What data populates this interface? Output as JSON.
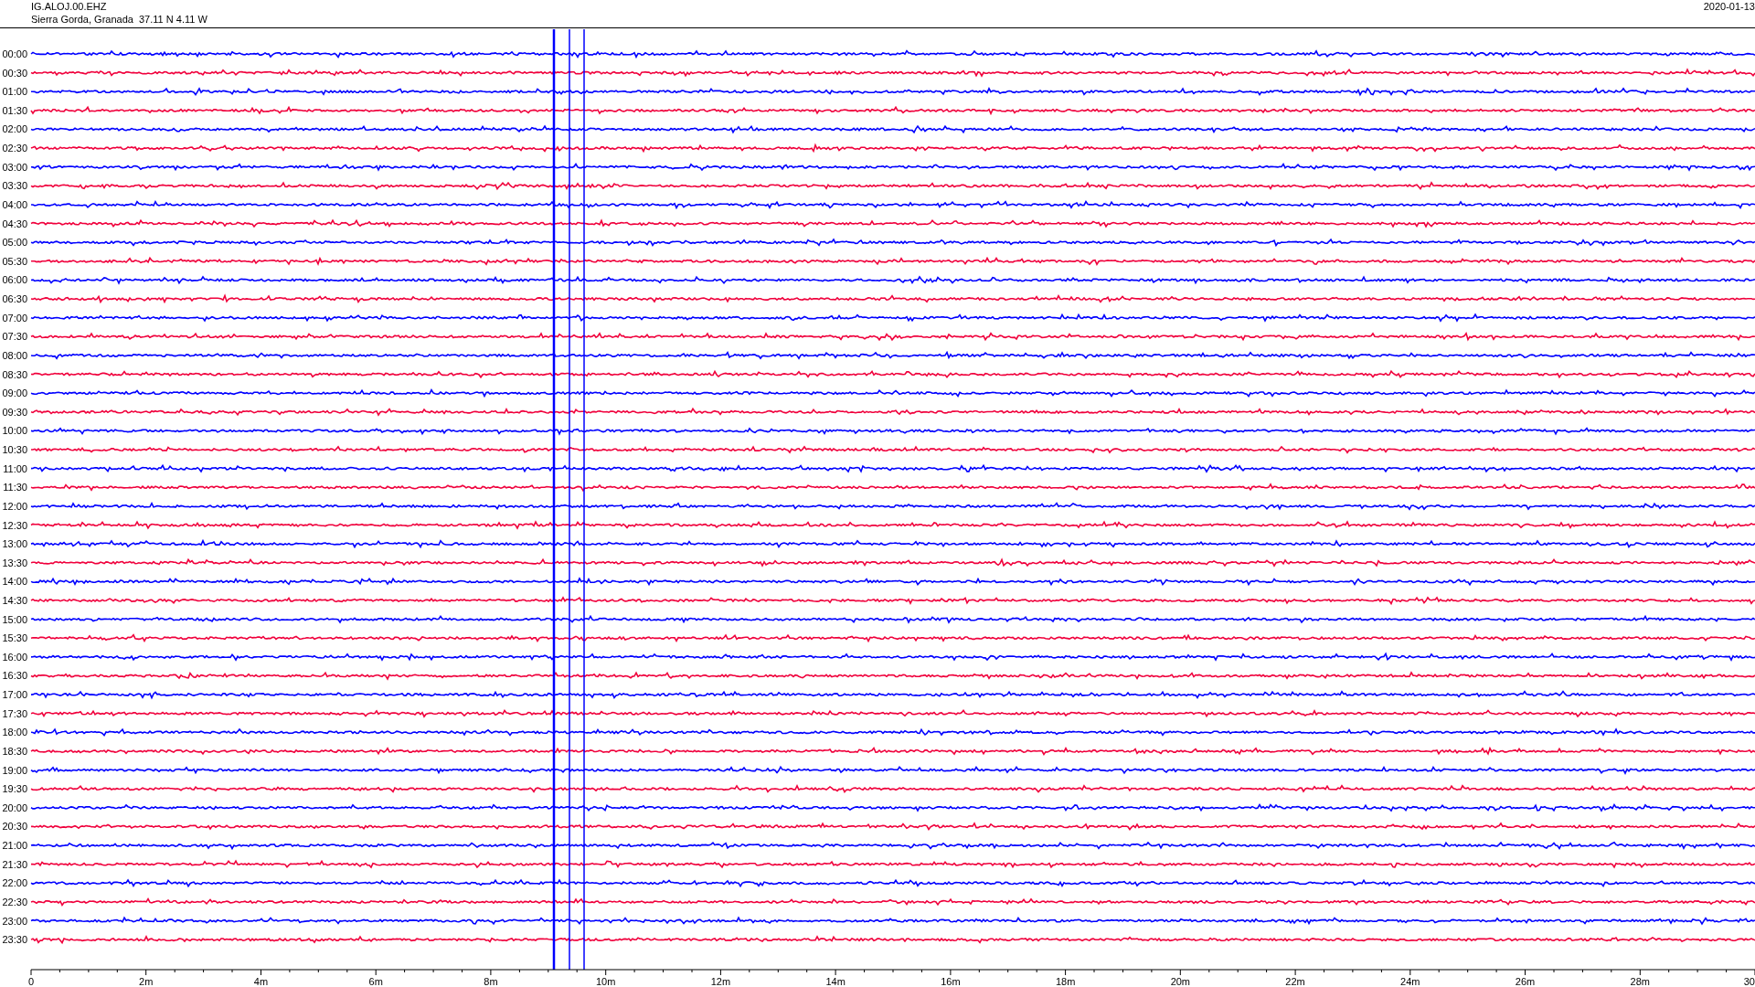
{
  "header": {
    "station": "IG.ALOJ.00.EHZ",
    "location": "Sierra Gorda, Granada  37.11 N 4.11 W",
    "date": "2020-01-13"
  },
  "traces": [
    {
      "label": "00:00",
      "color": "#0000ff"
    },
    {
      "label": "00:30",
      "color": "#f0003c"
    },
    {
      "label": "01:00",
      "color": "#0000ff"
    },
    {
      "label": "01:30",
      "color": "#f0003c"
    },
    {
      "label": "02:00",
      "color": "#0000ff"
    },
    {
      "label": "02:30",
      "color": "#f0003c"
    },
    {
      "label": "03:00",
      "color": "#0000ff"
    },
    {
      "label": "03:30",
      "color": "#f0003c"
    },
    {
      "label": "04:00",
      "color": "#0000ff"
    },
    {
      "label": "04:30",
      "color": "#f0003c"
    },
    {
      "label": "05:00",
      "color": "#0000ff"
    },
    {
      "label": "05:30",
      "color": "#f0003c"
    },
    {
      "label": "06:00",
      "color": "#0000ff"
    },
    {
      "label": "06:30",
      "color": "#f0003c"
    },
    {
      "label": "07:00",
      "color": "#0000ff"
    },
    {
      "label": "07:30",
      "color": "#f0003c"
    },
    {
      "label": "08:00",
      "color": "#0000ff"
    },
    {
      "label": "08:30",
      "color": "#f0003c"
    },
    {
      "label": "09:00",
      "color": "#0000ff"
    },
    {
      "label": "09:30",
      "color": "#f0003c"
    },
    {
      "label": "10:00",
      "color": "#0000ff"
    },
    {
      "label": "10:30",
      "color": "#f0003c"
    },
    {
      "label": "11:00",
      "color": "#0000ff"
    },
    {
      "label": "11:30",
      "color": "#f0003c"
    },
    {
      "label": "12:00",
      "color": "#0000ff"
    },
    {
      "label": "12:30",
      "color": "#f0003c"
    },
    {
      "label": "13:00",
      "color": "#0000ff"
    },
    {
      "label": "13:30",
      "color": "#f0003c"
    },
    {
      "label": "14:00",
      "color": "#0000ff"
    },
    {
      "label": "14:30",
      "color": "#f0003c"
    },
    {
      "label": "15:00",
      "color": "#0000ff"
    },
    {
      "label": "15:30",
      "color": "#f0003c"
    },
    {
      "label": "16:00",
      "color": "#0000ff"
    },
    {
      "label": "16:30",
      "color": "#f0003c"
    },
    {
      "label": "17:00",
      "color": "#0000ff"
    },
    {
      "label": "17:30",
      "color": "#f0003c"
    },
    {
      "label": "18:00",
      "color": "#0000ff"
    },
    {
      "label": "18:30",
      "color": "#f0003c"
    },
    {
      "label": "19:00",
      "color": "#0000ff"
    },
    {
      "label": "19:30",
      "color": "#f0003c"
    },
    {
      "label": "20:00",
      "color": "#0000ff"
    },
    {
      "label": "20:30",
      "color": "#f0003c"
    },
    {
      "label": "21:00",
      "color": "#0000ff"
    },
    {
      "label": "21:30",
      "color": "#f0003c"
    },
    {
      "label": "22:00",
      "color": "#0000ff"
    },
    {
      "label": "22:30",
      "color": "#f0003c"
    },
    {
      "label": "23:00",
      "color": "#0000ff"
    },
    {
      "label": "23:30",
      "color": "#f0003c"
    }
  ],
  "x_axis": {
    "labels": [
      "0",
      "2m",
      "4m",
      "6m",
      "8m",
      "10m",
      "12m",
      "14m",
      "16m",
      "18m",
      "20m",
      "22m",
      "24m",
      "26m",
      "28m",
      "30"
    ]
  }
}
